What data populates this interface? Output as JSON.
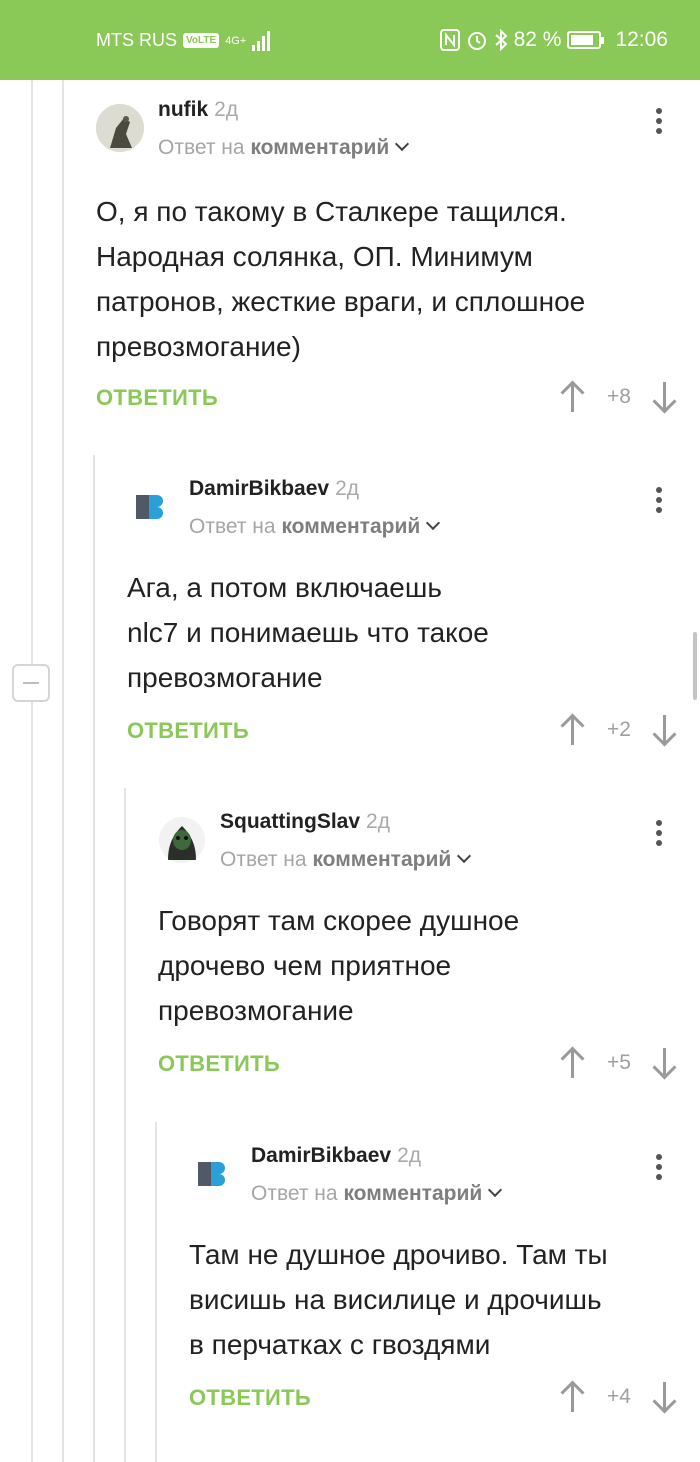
{
  "status_bar": {
    "carrier": "MTS RUS",
    "volte": "VoLTE",
    "network": "4G+",
    "battery_percent": "82 %",
    "battery_level": 0.82,
    "time": "12:06"
  },
  "reply_to_prefix": "Ответ на",
  "reply_to_target": "комментарий",
  "reply_label": "ОТВЕТИТЬ",
  "comments": [
    {
      "author": "nufik",
      "age": "2д",
      "text": [
        "О, я по такому в Сталкере тащился.",
        "Народная солянка, ОП. Минимум",
        "патронов, жесткие враги, и сплошное",
        "превозмогание)"
      ],
      "score": "+8"
    },
    {
      "author": "DamirBikbaev",
      "age": "2д",
      "text": [
        "Ага, а потом включаешь",
        "nlc7 и понимаешь что такое",
        "превозмогание"
      ],
      "score": "+2"
    },
    {
      "author": "SquattingSlav",
      "age": "2д",
      "text": [
        "Говорят там скорее душное",
        "дрочево чем приятное",
        "превозмогание"
      ],
      "score": "+5"
    },
    {
      "author": "DamirBikbaev",
      "age": "2д",
      "text": [
        "Там не душное дрочиво. Там ты",
        "висишь на висилице и дрочишь",
        "в перчатках с гвоздями"
      ],
      "score": "+4"
    }
  ]
}
